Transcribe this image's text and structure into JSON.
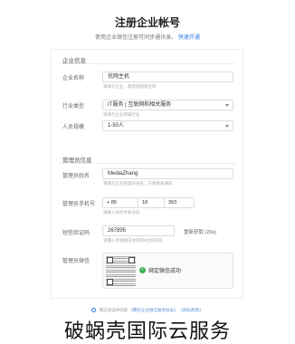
{
  "header": {
    "title": "注册企业帐号",
    "subtitle_text": "使用企业微信注册可同步通讯录。",
    "subtitle_link": "快速开通"
  },
  "company_section": {
    "title": "企业信息",
    "name_label": "企业名称",
    "name_value": "优网主机",
    "name_hint": "请填写企业、政府或组织名称",
    "industry_label": "行业类型",
    "industry_value": "IT服务 | 互联网和相关服务",
    "industry_hint": "请填写企业所属行业",
    "size_label": "人员规模",
    "size_value": "1-50人"
  },
  "admin_section": {
    "title": "管理员信息",
    "name_label": "管理员姓名",
    "name_value": "MediaZhang",
    "name_hint": "请填写企业管理员姓名，方便接收通知",
    "phone_label": "管理员手机号",
    "phone_country": "+ 86",
    "phone_part2": "18",
    "phone_part3": "393",
    "phone_hint": "请输入你的手机号码",
    "code_label": "短信验证码",
    "code_value": "267895",
    "code_hint": "请输入手机短信收到的6位验证码",
    "resend_label": "重新获取 (29s)",
    "wechat_label": "管理员微信",
    "wechat_status": "绑定微信成功"
  },
  "footer": {
    "agree_text": "我已阅读并同意",
    "link1": "《腾讯企业微信服务协议》",
    "link2": "《隐私政策》"
  },
  "watermark": "破蜗壳国际云服务",
  "colors": {
    "link": "#2b7de0",
    "success": "#3fb05a"
  }
}
